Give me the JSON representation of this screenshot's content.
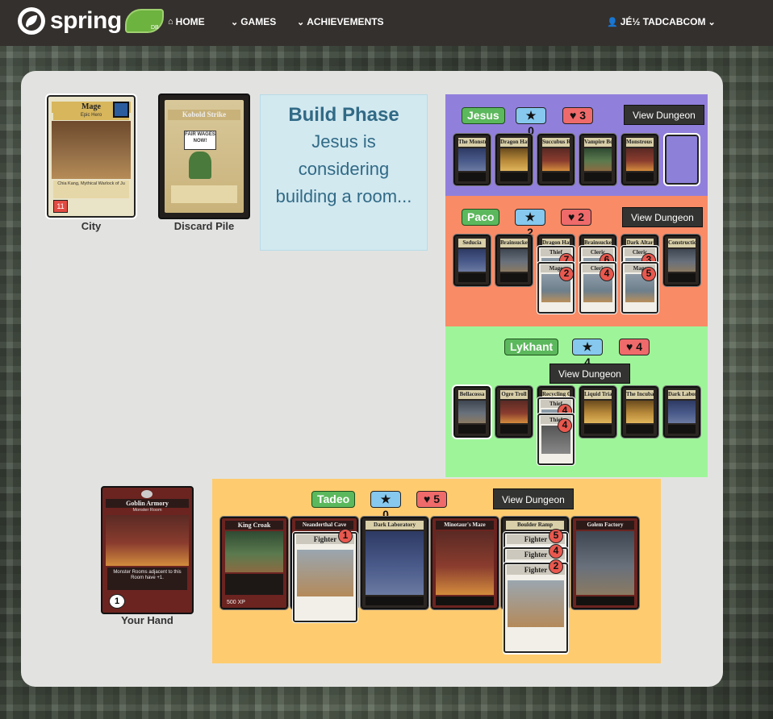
{
  "nav": {
    "logo_text": "spring",
    "logo_badge": "DB",
    "home": "HOME",
    "games": "GAMES",
    "achievements": "ACHIEVEMENTS",
    "user": "Jé½ TADCABCOM"
  },
  "city": {
    "label": "City",
    "card_title": "Mage",
    "card_subtitle": "Epic Hero",
    "card_text": "Chia Kang, Mythical Warlock of Ju",
    "health": "11"
  },
  "discard": {
    "label": "Discard Pile",
    "card_title": "Kobold Strike",
    "sign_text": "FAIR WAGES NOW!"
  },
  "phase": {
    "title": "Build Phase",
    "message": "Jesus is considering building a room..."
  },
  "players": [
    {
      "name": "Jesus",
      "stars": "0",
      "hearts": "3",
      "button": "View Dungeon",
      "color": "#917fdc",
      "rooms": [
        "The Monstrous Maw",
        "Dragon Hatchery",
        "Succubus Retreat",
        "Vampire Bordello",
        "Monstrous Monument"
      ]
    },
    {
      "name": "Paco",
      "stars": "2",
      "hearts": "2",
      "button": "View Dungeon",
      "color": "#f98b66",
      "rooms": [
        "Seducia",
        "Brainsucker Hive",
        "Dragon Hatchery",
        "Brainsucker Hive",
        "Dark Altar",
        "Construction Pit"
      ],
      "heroes": [
        {
          "slot": 2,
          "cards": [
            {
              "title": "Thief",
              "num": "7"
            },
            {
              "title": "Mage",
              "num": "2"
            }
          ]
        },
        {
          "slot": 3,
          "cards": [
            {
              "title": "Cleric",
              "num": "6"
            },
            {
              "title": "Cleric",
              "num": "4"
            }
          ]
        },
        {
          "slot": 4,
          "cards": [
            {
              "title": "Cleric",
              "num": "3"
            },
            {
              "title": "Mage",
              "num": "5"
            }
          ]
        }
      ]
    },
    {
      "name": "Lykhant",
      "stars": "4",
      "hearts": "4",
      "button": "View Dungeon",
      "color": "#9ef599",
      "rooms": [
        "Bellacossa",
        "Ogre Troll",
        "Recycling Center",
        "Liquid Trial",
        "The Incubator",
        "Dark Laboratory"
      ],
      "heroes": [
        {
          "slot": 2,
          "cards": [
            {
              "title": "Thief",
              "num": "4"
            },
            {
              "title": "Thief",
              "num": "4"
            }
          ]
        }
      ]
    },
    {
      "name": "Tadeo",
      "stars": "0",
      "hearts": "5",
      "button": "View Dungeon",
      "color": "#ffcb6f",
      "rooms": [
        "King Croak",
        "Neanderthal Cave",
        "Dark Laboratory",
        "Minotaur's Maze",
        "Boulder Ramp",
        "Golem Factory"
      ],
      "boss_xp": "500 XP",
      "heroes": [
        {
          "slot": 1,
          "cards": [
            {
              "title": "Fighter",
              "num": "1"
            }
          ]
        },
        {
          "slot": 4,
          "cards": [
            {
              "title": "Fighter",
              "num": "5"
            },
            {
              "title": "Fighter",
              "num": "4"
            },
            {
              "title": "Fighter",
              "num": "2"
            }
          ]
        }
      ]
    }
  ],
  "hand": {
    "label": "Your Hand",
    "card_title": "Goblin Armory",
    "card_subtitle": "Monster Room",
    "card_text": "Monster Rooms adjacent to this Room have +1.",
    "damage": "1"
  },
  "icons": [
    "home-icon",
    "chevron-down-icon",
    "user-icon",
    "star-icon",
    "heart-icon"
  ]
}
